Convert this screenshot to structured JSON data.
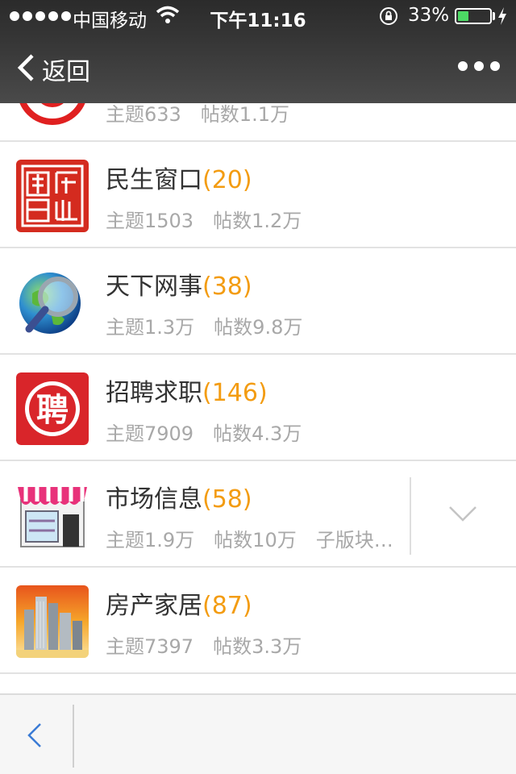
{
  "status_bar": {
    "carrier": "中国移动",
    "time": "下午11:16",
    "battery_pct": "33%",
    "battery_level": 0.33,
    "icons": [
      "signal-icon",
      "wifi-icon",
      "orientation-lock-icon",
      "battery-icon",
      "charging-icon"
    ]
  },
  "nav": {
    "back_label": "返回",
    "more_icon": "more-dots-icon"
  },
  "forums": [
    {
      "name": "",
      "count": "",
      "topics": "主题633",
      "posts": "帖数1.1万",
      "sub": "",
      "icon": "red-circle-icon",
      "partial": true
    },
    {
      "name": "民生窗口",
      "count": "(20)",
      "topics": "主题1503",
      "posts": "帖数1.2万",
      "sub": "",
      "icon": "seal-stamp-icon"
    },
    {
      "name": "天下网事",
      "count": "(38)",
      "topics": "主题1.3万",
      "posts": "帖数9.8万",
      "sub": "",
      "icon": "globe-magnifier-icon"
    },
    {
      "name": "招聘求职",
      "count": "(146)",
      "topics": "主题7909",
      "posts": "帖数4.3万",
      "sub": "",
      "icon": "hire-badge-icon"
    },
    {
      "name": "市场信息",
      "count": "(58)",
      "topics": "主题1.9万",
      "posts": "帖数10万",
      "sub": "子版块…",
      "icon": "storefront-icon",
      "expandable": true
    },
    {
      "name": "房产家居",
      "count": "(87)",
      "topics": "主题7397",
      "posts": "帖数3.3万",
      "sub": "",
      "icon": "skyscrapers-icon"
    }
  ],
  "hire_char": "聘",
  "colors": {
    "count": "#f39c12",
    "meta": "#a8a8a8",
    "title": "#333333",
    "battery": "#4cd964"
  },
  "toolbar": {
    "back_icon": "chevron-left-icon"
  }
}
